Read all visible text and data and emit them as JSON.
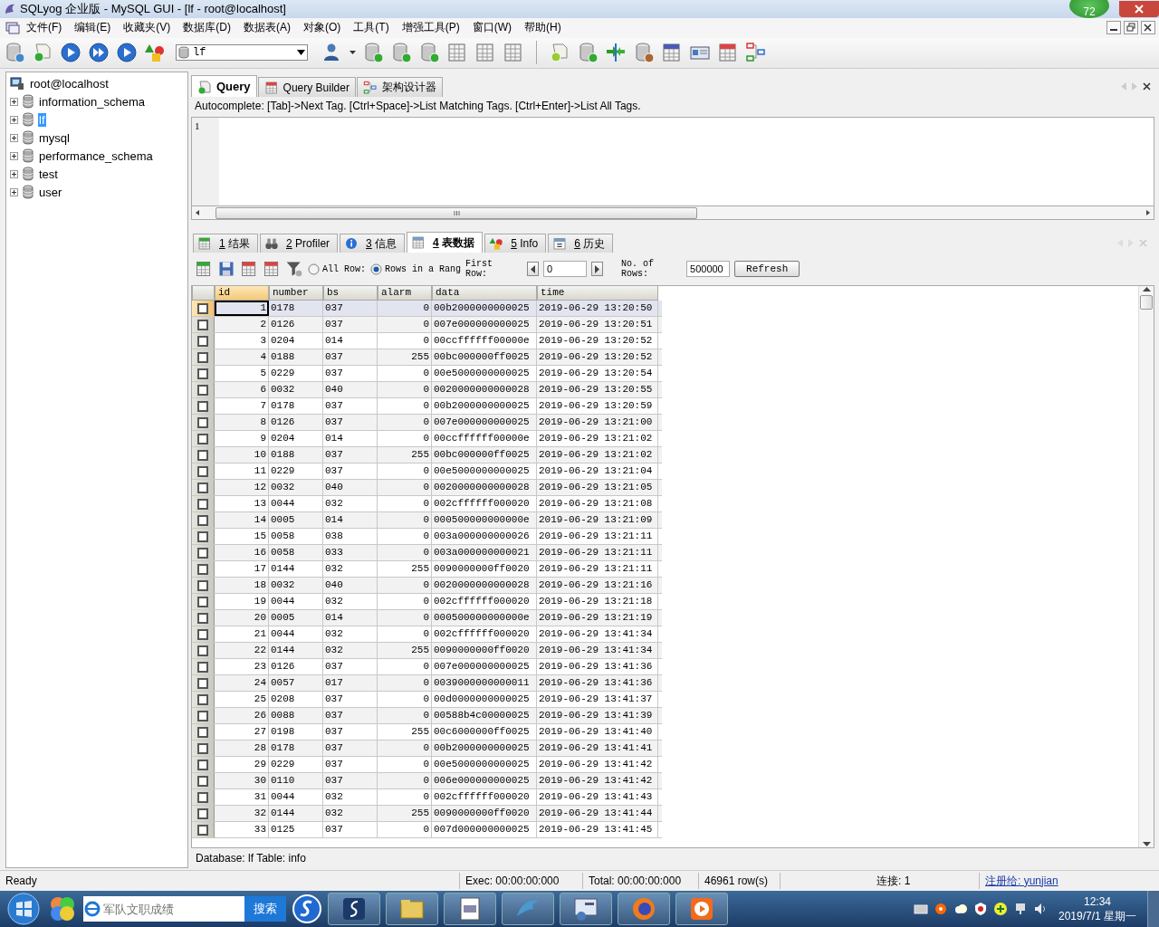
{
  "window": {
    "title": "SQLyog 企业版 - MySQL GUI - [lf - root@localhost]",
    "badge": "72"
  },
  "menu": [
    "文件(F)",
    "编辑(E)",
    "收藏夹(V)",
    "数据库(D)",
    "数据表(A)",
    "对象(O)",
    "工具(T)",
    "增强工具(P)",
    "窗口(W)",
    "帮助(H)"
  ],
  "toolbar": {
    "database_select": "lf"
  },
  "tree": {
    "root": "root@localhost",
    "items": [
      {
        "label": "information_schema",
        "selected": false,
        "expanded": false
      },
      {
        "label": "lf",
        "selected": true,
        "expanded": false
      },
      {
        "label": "mysql",
        "selected": false,
        "expanded": false
      },
      {
        "label": "performance_schema",
        "selected": false,
        "expanded": false
      },
      {
        "label": "test",
        "selected": false,
        "expanded": false
      },
      {
        "label": "user",
        "selected": false,
        "expanded": false
      }
    ]
  },
  "query_tabs": [
    {
      "label": "Query",
      "selected": true
    },
    {
      "label": "Query Builder",
      "selected": false
    },
    {
      "label": "架构设计器",
      "selected": false
    }
  ],
  "autocomplete_hint": "Autocomplete: [Tab]->Next Tag. [Ctrl+Space]->List Matching Tags. [Ctrl+Enter]->List All Tags.",
  "editor": {
    "line_numbers": [
      "1"
    ]
  },
  "result_tabs": [
    {
      "number": "1",
      "label": "结果",
      "selected": false
    },
    {
      "number": "2",
      "label": "Profiler",
      "selected": false
    },
    {
      "number": "3",
      "label": "信息",
      "selected": false
    },
    {
      "number": "4",
      "label": "表数据",
      "selected": true
    },
    {
      "number": "5",
      "label": "Info",
      "selected": false
    },
    {
      "number": "6",
      "label": "历史",
      "selected": false
    }
  ],
  "data_toolbar": {
    "range_options": [
      {
        "label": "All Row:",
        "selected": false
      },
      {
        "label": "Rows in a Rang",
        "selected": true
      }
    ],
    "first_row_label": "First Row:",
    "first_row": "0",
    "rows_label": "No. of Rows:",
    "rows": "500000",
    "refresh": "Refresh"
  },
  "table": {
    "columns": [
      {
        "label": "id",
        "numeric": true,
        "selected": true
      },
      {
        "label": "number",
        "numeric": false,
        "selected": false
      },
      {
        "label": "bs",
        "numeric": false,
        "selected": false
      },
      {
        "label": "alarm",
        "numeric": true,
        "selected": false
      },
      {
        "label": "data",
        "numeric": false,
        "selected": false
      },
      {
        "label": "time",
        "numeric": false,
        "selected": false
      }
    ],
    "rows": [
      {
        "selected": true,
        "checked": false,
        "cells": [
          "1",
          "0178",
          "037",
          "0",
          "00b2000000000025",
          "2019-06-29 13:20:50"
        ]
      },
      {
        "selected": false,
        "checked": false,
        "cells": [
          "2",
          "0126",
          "037",
          "0",
          "007e000000000025",
          "2019-06-29 13:20:51"
        ]
      },
      {
        "selected": false,
        "checked": false,
        "cells": [
          "3",
          "0204",
          "014",
          "0",
          "00ccffffff00000e",
          "2019-06-29 13:20:52"
        ]
      },
      {
        "selected": false,
        "checked": false,
        "cells": [
          "4",
          "0188",
          "037",
          "255",
          "00bc000000ff0025",
          "2019-06-29 13:20:52"
        ]
      },
      {
        "selected": false,
        "checked": false,
        "cells": [
          "5",
          "0229",
          "037",
          "0",
          "00e5000000000025",
          "2019-06-29 13:20:54"
        ]
      },
      {
        "selected": false,
        "checked": false,
        "cells": [
          "6",
          "0032",
          "040",
          "0",
          "0020000000000028",
          "2019-06-29 13:20:55"
        ]
      },
      {
        "selected": false,
        "checked": false,
        "cells": [
          "7",
          "0178",
          "037",
          "0",
          "00b2000000000025",
          "2019-06-29 13:20:59"
        ]
      },
      {
        "selected": false,
        "checked": false,
        "cells": [
          "8",
          "0126",
          "037",
          "0",
          "007e000000000025",
          "2019-06-29 13:21:00"
        ]
      },
      {
        "selected": false,
        "checked": false,
        "cells": [
          "9",
          "0204",
          "014",
          "0",
          "00ccffffff00000e",
          "2019-06-29 13:21:02"
        ]
      },
      {
        "selected": false,
        "checked": false,
        "cells": [
          "10",
          "0188",
          "037",
          "255",
          "00bc000000ff0025",
          "2019-06-29 13:21:02"
        ]
      },
      {
        "selected": false,
        "checked": false,
        "cells": [
          "11",
          "0229",
          "037",
          "0",
          "00e5000000000025",
          "2019-06-29 13:21:04"
        ]
      },
      {
        "selected": false,
        "checked": false,
        "cells": [
          "12",
          "0032",
          "040",
          "0",
          "0020000000000028",
          "2019-06-29 13:21:05"
        ]
      },
      {
        "selected": false,
        "checked": false,
        "cells": [
          "13",
          "0044",
          "032",
          "0",
          "002cffffff000020",
          "2019-06-29 13:21:08"
        ]
      },
      {
        "selected": false,
        "checked": false,
        "cells": [
          "14",
          "0005",
          "014",
          "0",
          "000500000000000e",
          "2019-06-29 13:21:09"
        ]
      },
      {
        "selected": false,
        "checked": false,
        "cells": [
          "15",
          "0058",
          "038",
          "0",
          "003a000000000026",
          "2019-06-29 13:21:11"
        ]
      },
      {
        "selected": false,
        "checked": false,
        "cells": [
          "16",
          "0058",
          "033",
          "0",
          "003a000000000021",
          "2019-06-29 13:21:11"
        ]
      },
      {
        "selected": false,
        "checked": false,
        "cells": [
          "17",
          "0144",
          "032",
          "255",
          "0090000000ff0020",
          "2019-06-29 13:21:11"
        ]
      },
      {
        "selected": false,
        "checked": false,
        "cells": [
          "18",
          "0032",
          "040",
          "0",
          "0020000000000028",
          "2019-06-29 13:21:16"
        ]
      },
      {
        "selected": false,
        "checked": false,
        "cells": [
          "19",
          "0044",
          "032",
          "0",
          "002cffffff000020",
          "2019-06-29 13:21:18"
        ]
      },
      {
        "selected": false,
        "checked": false,
        "cells": [
          "20",
          "0005",
          "014",
          "0",
          "000500000000000e",
          "2019-06-29 13:21:19"
        ]
      },
      {
        "selected": false,
        "checked": false,
        "cells": [
          "21",
          "0044",
          "032",
          "0",
          "002cffffff000020",
          "2019-06-29 13:41:34"
        ]
      },
      {
        "selected": false,
        "checked": false,
        "cells": [
          "22",
          "0144",
          "032",
          "255",
          "0090000000ff0020",
          "2019-06-29 13:41:34"
        ]
      },
      {
        "selected": false,
        "checked": false,
        "cells": [
          "23",
          "0126",
          "037",
          "0",
          "007e000000000025",
          "2019-06-29 13:41:36"
        ]
      },
      {
        "selected": false,
        "checked": false,
        "cells": [
          "24",
          "0057",
          "017",
          "0",
          "0039000000000011",
          "2019-06-29 13:41:36"
        ]
      },
      {
        "selected": false,
        "checked": false,
        "cells": [
          "25",
          "0208",
          "037",
          "0",
          "00d0000000000025",
          "2019-06-29 13:41:37"
        ]
      },
      {
        "selected": false,
        "checked": false,
        "cells": [
          "26",
          "0088",
          "037",
          "0",
          "00588b4c00000025",
          "2019-06-29 13:41:39"
        ]
      },
      {
        "selected": false,
        "checked": false,
        "cells": [
          "27",
          "0198",
          "037",
          "255",
          "00c6000000ff0025",
          "2019-06-29 13:41:40"
        ]
      },
      {
        "selected": false,
        "checked": false,
        "cells": [
          "28",
          "0178",
          "037",
          "0",
          "00b2000000000025",
          "2019-06-29 13:41:41"
        ]
      },
      {
        "selected": false,
        "checked": false,
        "cells": [
          "29",
          "0229",
          "037",
          "0",
          "00e5000000000025",
          "2019-06-29 13:41:42"
        ]
      },
      {
        "selected": false,
        "checked": false,
        "cells": [
          "30",
          "0110",
          "037",
          "0",
          "006e000000000025",
          "2019-06-29 13:41:42"
        ]
      },
      {
        "selected": false,
        "checked": false,
        "cells": [
          "31",
          "0044",
          "032",
          "0",
          "002cffffff000020",
          "2019-06-29 13:41:43"
        ]
      },
      {
        "selected": false,
        "checked": false,
        "cells": [
          "32",
          "0144",
          "032",
          "255",
          "0090000000ff0020",
          "2019-06-29 13:41:44"
        ]
      },
      {
        "selected": false,
        "checked": false,
        "cells": [
          "33",
          "0125",
          "037",
          "0",
          "007d000000000025",
          "2019-06-29 13:41:45"
        ]
      }
    ]
  },
  "info_line": "Database: lf Table: info",
  "status_bar": [
    "Ready",
    "Exec: 00:00:00:000",
    "Total: 00:00:00:000",
    "46961 row(s)",
    "连接: 1"
  ],
  "registered_link": "注册给: yunjian",
  "taskbar": {
    "search_placeholder": "军队文职成绩",
    "search_button": "搜索",
    "time": "12:34",
    "date": "2019/7/1 星期一"
  }
}
